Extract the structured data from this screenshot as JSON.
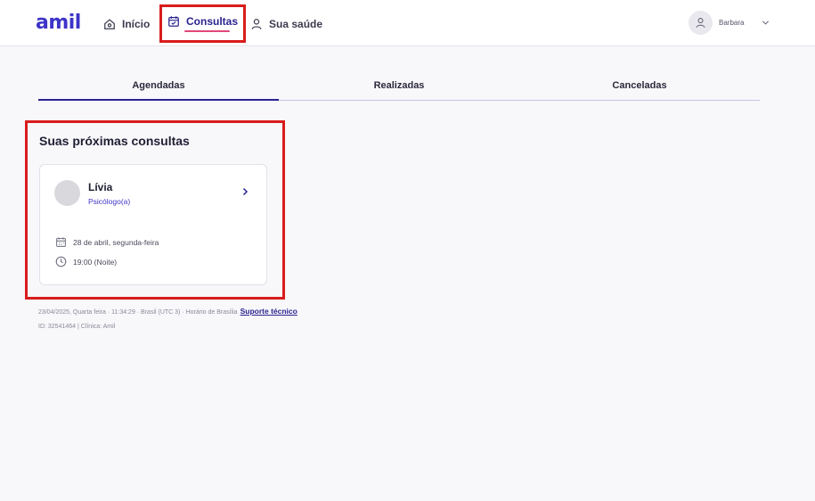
{
  "brand": {
    "logo_text": "amil",
    "color": "#3d34c8"
  },
  "nav": {
    "items": [
      {
        "label": "Início",
        "icon": "home-icon"
      },
      {
        "label": "Consultas",
        "icon": "calendar-check-icon",
        "active": true
      },
      {
        "label": "Sua saúde",
        "icon": "person-icon"
      }
    ]
  },
  "user": {
    "name": "Barbara",
    "icon": "user-icon"
  },
  "tabs": [
    {
      "label": "Agendadas",
      "active": true
    },
    {
      "label": "Realizadas"
    },
    {
      "label": "Canceladas"
    }
  ],
  "section": {
    "title": "Suas próximas consultas",
    "card": {
      "name": "Lívia",
      "role": "Psicólogo(a)",
      "date": "28 de abril, segunda-feira",
      "time": "19:00 (Noite)"
    }
  },
  "footer": {
    "meta": "23/04/2025, Quarta feira · 11:34:29 · Brasil (UTC 3) · Horário de Brasília",
    "support_link": "Suporte técnico",
    "id_line": "ID: 32541464 | Clínica: Amil"
  },
  "colors": {
    "accent": "#2b2390",
    "underline": "#e2477a",
    "highlight": "#d91c1c"
  }
}
